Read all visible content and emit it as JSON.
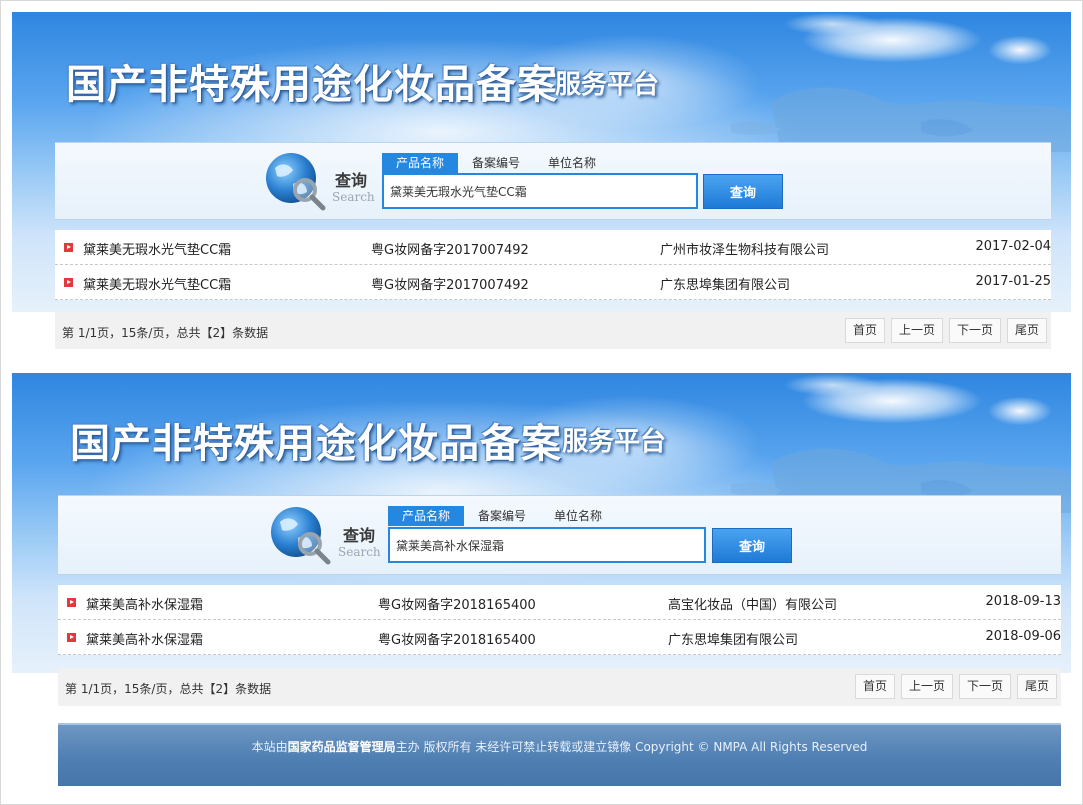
{
  "header": {
    "title": "国产非特殊用途化妆品备案",
    "subtitle": "服务平台"
  },
  "search": {
    "label_cn": "查询",
    "label_en": "Search",
    "tabs": [
      "产品名称",
      "备案编号",
      "单位名称"
    ],
    "button": "查询"
  },
  "panels": [
    {
      "query": "黛莱美无瑕水光气垫CC霜",
      "rows": [
        {
          "name": "黛莱美无瑕水光气垫CC霜",
          "reg": "粤G妆网备字2017007492",
          "company": "广州市妆泽生物科技有限公司",
          "date": "2017-02-04"
        },
        {
          "name": "黛莱美无瑕水光气垫CC霜",
          "reg": "粤G妆网备字2017007492",
          "company": "广东思埠集团有限公司",
          "date": "2017-01-25"
        }
      ]
    },
    {
      "query": "黛莱美高补水保湿霜",
      "rows": [
        {
          "name": "黛莱美高补水保湿霜",
          "reg": "粤G妆网备字2018165400",
          "company": "高宝化妆品（中国）有限公司",
          "date": "2018-09-13"
        },
        {
          "name": "黛莱美高补水保湿霜",
          "reg": "粤G妆网备字2018165400",
          "company": "广东思埠集团有限公司",
          "date": "2018-09-06"
        }
      ]
    }
  ],
  "pager": {
    "info": "第 1/1页，15条/页，总共【2】条数据",
    "first": "首页",
    "prev": "上一页",
    "next": "下一页",
    "last": "尾页"
  },
  "footer": {
    "prefix": "本站由",
    "org": "国家药品监督管理局",
    "suffix": "主办 版权所有 未经许可禁止转载或建立镜像 Copyright © NMPA All Rights Reserved"
  },
  "colors": {
    "accent": "#2488e0",
    "bullet": "#e4393c",
    "footer": "#4f7fb3"
  }
}
